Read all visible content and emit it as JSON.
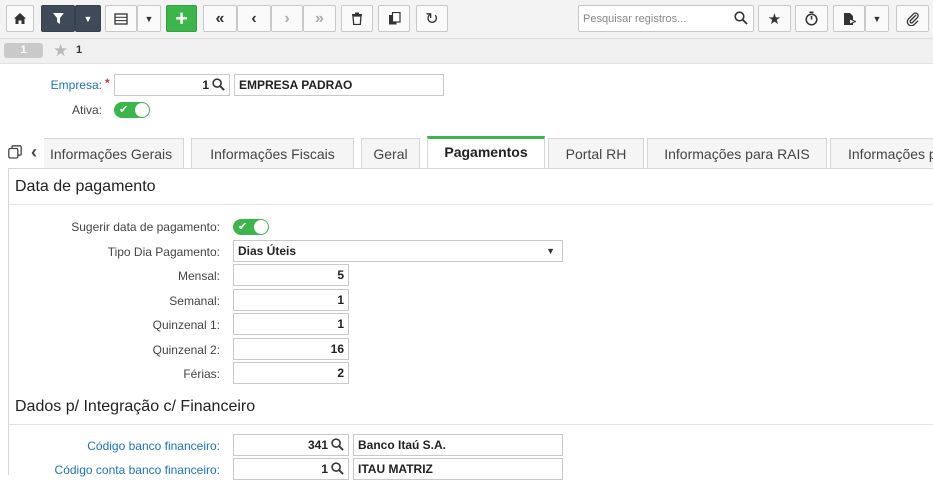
{
  "toolbar": {
    "search_placeholder": "Pesquisar registros...",
    "icons": [
      "home-icon",
      "filter-icon",
      "grid-icon",
      "add-icon",
      "first-icon",
      "prev-icon",
      "next-icon",
      "last-icon",
      "delete-icon",
      "copy-icon",
      "refresh-icon",
      "search-icon",
      "star-icon",
      "timer-icon",
      "export-icon",
      "attach-icon"
    ],
    "accent": "#3cb64a",
    "dark": "#3e4a57"
  },
  "record": {
    "number": "1",
    "label": "1"
  },
  "header": {
    "empresa_label": "Empresa:",
    "empresa_required": "*",
    "empresa_code": "1",
    "empresa_name": "EMPRESA PADRAO",
    "ativa_label": "Ativa:"
  },
  "tabs": [
    {
      "label": "Informações Gerais"
    },
    {
      "label": "Informações Fiscais"
    },
    {
      "label": "Geral"
    },
    {
      "label": "Pagamentos"
    },
    {
      "label": "Portal RH"
    },
    {
      "label": "Informações para RAIS"
    },
    {
      "label": "Informações p"
    }
  ],
  "pagamento": {
    "title": "Data de pagamento",
    "sugerir_label": "Sugerir data de pagamento:",
    "tipo_label": "Tipo Dia Pagamento:",
    "tipo_value": "Dias Úteis",
    "mensal_label": "Mensal:",
    "mensal_value": "5",
    "semanal_label": "Semanal:",
    "semanal_value": "1",
    "quinzenal1_label": "Quinzenal 1:",
    "quinzenal1_value": "1",
    "quinzenal2_label": "Quinzenal 2:",
    "quinzenal2_value": "16",
    "ferias_label": "Férias:",
    "ferias_value": "2"
  },
  "integracao": {
    "title": "Dados p/ Integração c/ Financeiro",
    "banco_label": "Código banco financeiro:",
    "banco_code": "341",
    "banco_name": "Banco Itaú S.A.",
    "conta_label": "Código conta banco financeiro:",
    "conta_code": "1",
    "conta_name": "ITAU MATRIZ"
  }
}
